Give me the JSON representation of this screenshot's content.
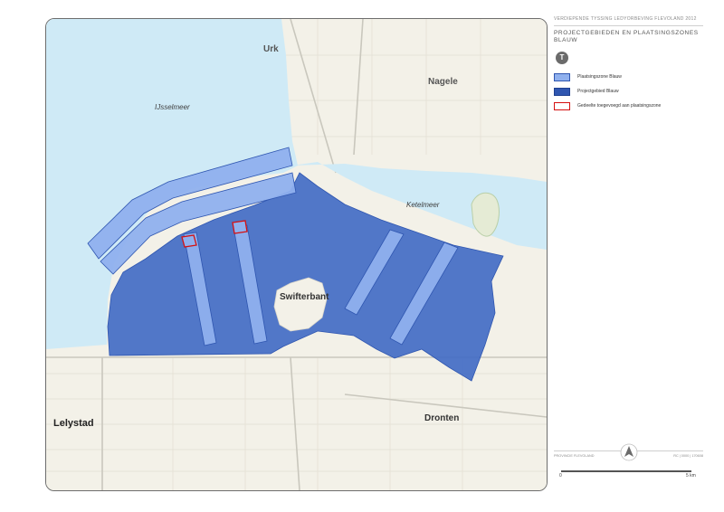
{
  "map": {
    "places": {
      "urk": "Urk",
      "nagele": "Nagele",
      "ijsselmeer": "IJsselmeer",
      "ketelmeer": "Ketelmeer",
      "swifterbant": "Swifterbant",
      "lelystad": "Lelystad",
      "dronten": "Dronten"
    },
    "colors": {
      "water": "#cfeaf6",
      "land": "#f3f1e8",
      "projectgebied": "#3f69c4",
      "plaatsingszone": "#8fb0ee",
      "toegevoegd": "#d51010"
    }
  },
  "panel": {
    "header": "VERDIEPENDE TYSSING LEDYORBEVING FLEVOLAND 2012",
    "title_line1": "PROJECTGEBIEDEN EN PLAATSINGSZONES",
    "title_line2": "BLAUW",
    "north_symbol": "T",
    "legend": [
      {
        "label": "Plaatsingszone Blauw"
      },
      {
        "label": "Projectgebied Blauw"
      },
      {
        "label": "Gedeelte toegevoegd aan plaatsingszone"
      }
    ],
    "footer_left": "PROVINCIE FLEVOLAND",
    "footer_right": "RC | 0000 | 170608",
    "scale_start": "0",
    "scale_end": "5 km"
  }
}
